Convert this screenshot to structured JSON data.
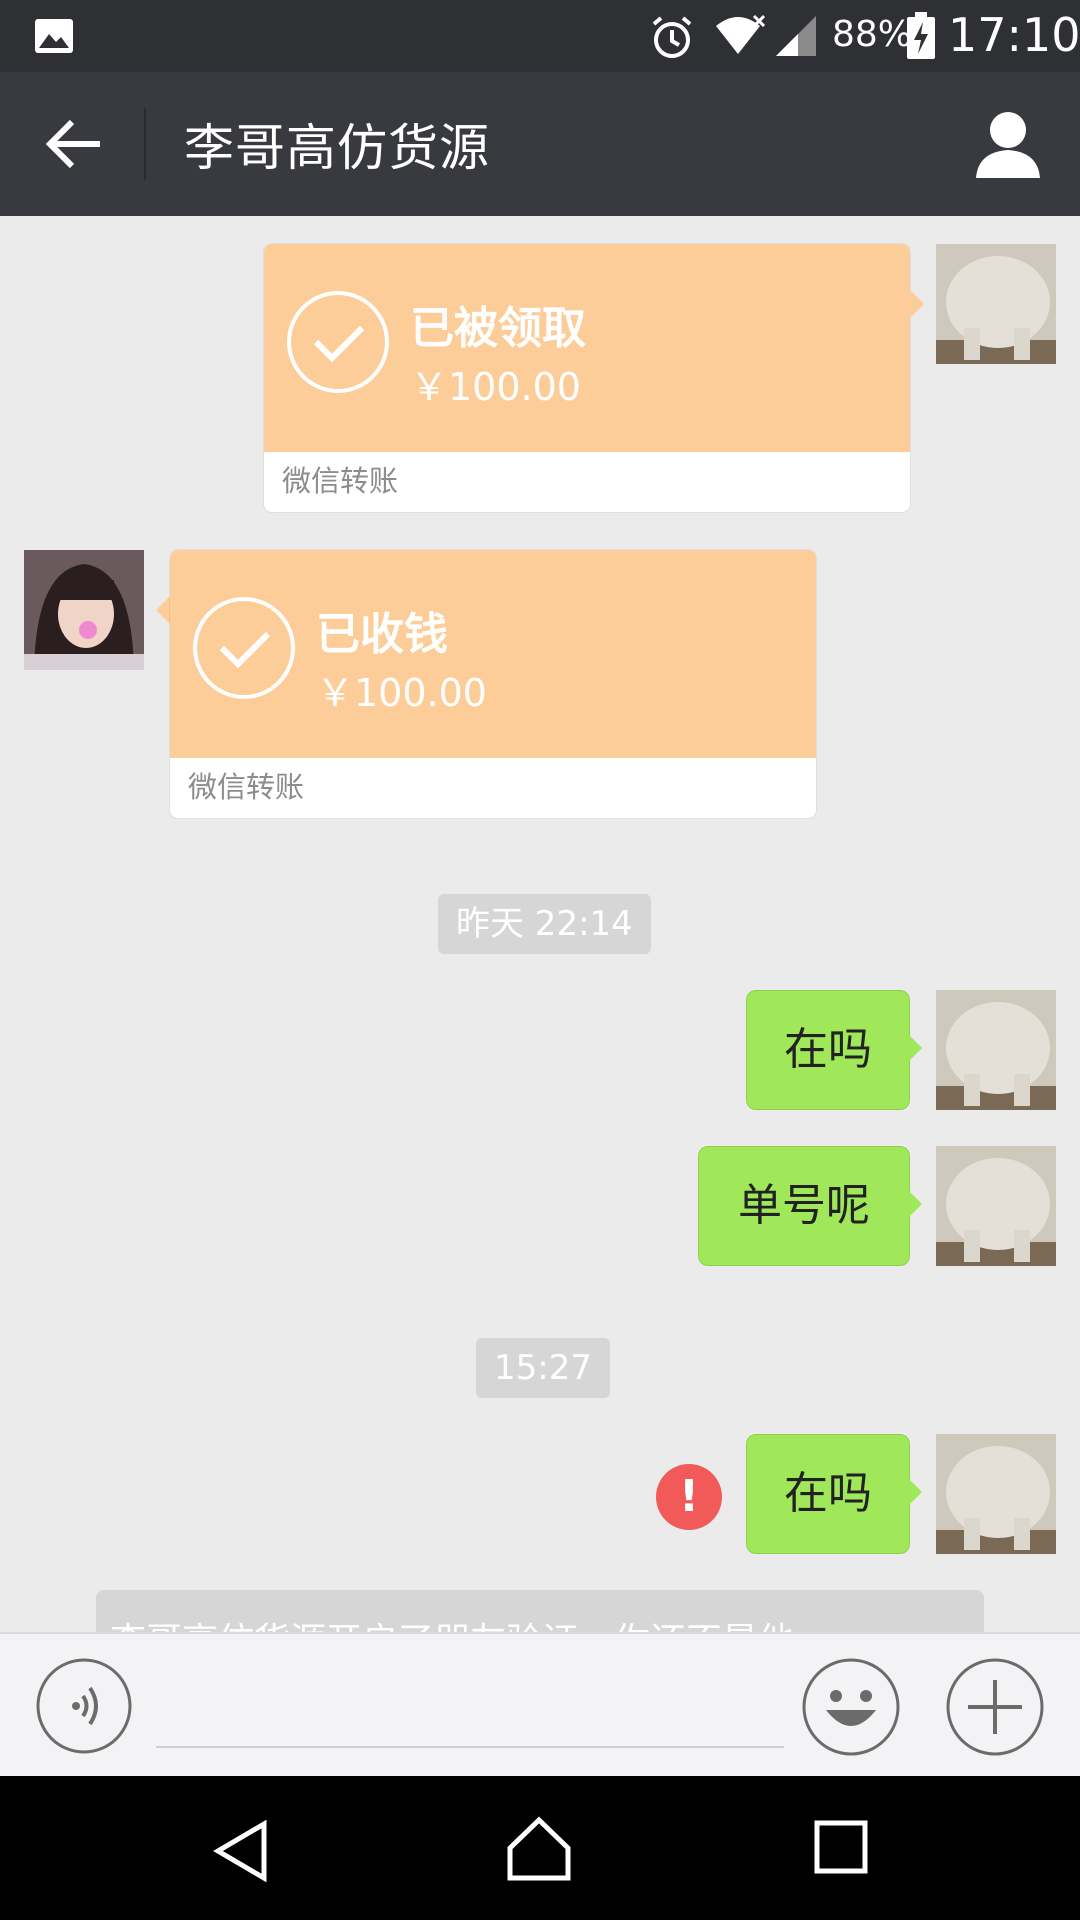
{
  "status_bar": {
    "battery": "88%",
    "time": "17:10",
    "icons": [
      "image-icon",
      "alarm-icon",
      "wifi-icon",
      "signal-icon",
      "battery-charging-icon"
    ]
  },
  "header": {
    "title": "李哥高仿货源",
    "icons": [
      "back-arrow-icon",
      "profile-icon"
    ]
  },
  "messages": {
    "transfer_sent": {
      "status": "已被领取",
      "amount": "￥100.00",
      "footer": "微信转账"
    },
    "transfer_received": {
      "status": "已收钱",
      "amount": "￥100.00",
      "footer": "微信转账"
    },
    "time_1": "昨天 22:14",
    "msg_1": "在吗",
    "msg_2": "单号呢",
    "time_2": "15:27",
    "msg_3": "在吗",
    "error_mark": "!",
    "system_notice": "李哥高仿货源开启了朋友验证，你还不是他"
  },
  "input_bar": {
    "message_value": "",
    "icons": [
      "voice-icon",
      "emoji-icon",
      "plus-icon"
    ]
  },
  "nav_bar": {
    "icons": [
      "nav-back-icon",
      "nav-home-icon",
      "nav-recent-icon"
    ]
  },
  "colors": {
    "titlebar": "#393a3f",
    "transfer_orange": "#fdcd99",
    "bubble_green": "#a0e75a",
    "error_red": "#f25a5a"
  }
}
